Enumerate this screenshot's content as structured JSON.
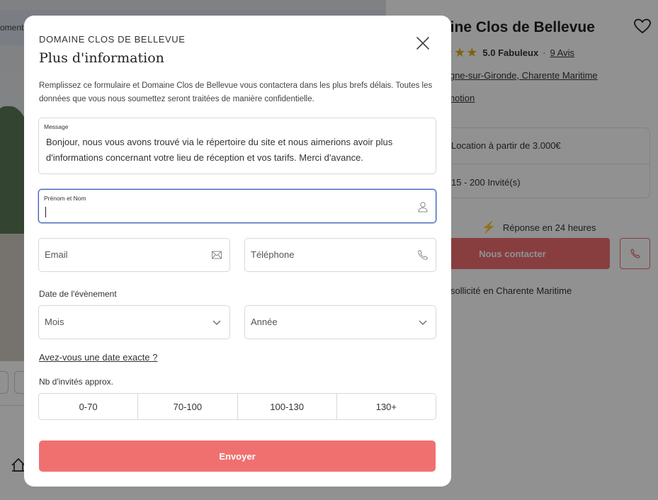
{
  "background": {
    "tab_fragment": "oment",
    "venue_title": "aine Clos de Bellevue",
    "rating_stars": "★★★",
    "rating_score": "5.0 Fabuleux",
    "rating_separator": "·",
    "rating_reviews": "9 Avis",
    "location": "tagne-sur-Gironde, Charente Maritime",
    "promo": "omotion",
    "price": "Location à partir de 3.000€",
    "guests": "15 - 200 Invité(s)",
    "response": "Réponse en 24 heures",
    "contact_label": "Nous contacter",
    "popular": "sollicité en Charente Maritime",
    "accent_color": "#ef6d6d"
  },
  "modal": {
    "eyebrow": "DOMAINE CLOS DE BELLEVUE",
    "title": "Plus d'information",
    "description": "Remplissez ce formulaire et Domaine Clos de Bellevue vous contactera dans les plus brefs délais. Toutes les données que vous nous soumettez seront traitées de manière confidentielle.",
    "message": {
      "label": "Message",
      "value": "Bonjour, nous vous avons trouvé via le répertoire du site et nous aimerions avoir plus d'informations concernant votre lieu de réception et vos tarifs. Merci d'avance."
    },
    "name": {
      "label": "Prénom et Nom",
      "value": ""
    },
    "email": {
      "placeholder": "Email"
    },
    "phone": {
      "placeholder": "Téléphone"
    },
    "date_label": "Date de l'évènement",
    "month": {
      "placeholder": "Mois"
    },
    "year": {
      "placeholder": "Année"
    },
    "exact_date_link": "Avez-vous une date exacte ?",
    "guests_label": "Nb d'invités approx.",
    "guest_options": [
      "0-70",
      "70-100",
      "100-130",
      "130+"
    ],
    "submit_label": "Envoyer",
    "focus_color": "#3a5db8"
  }
}
